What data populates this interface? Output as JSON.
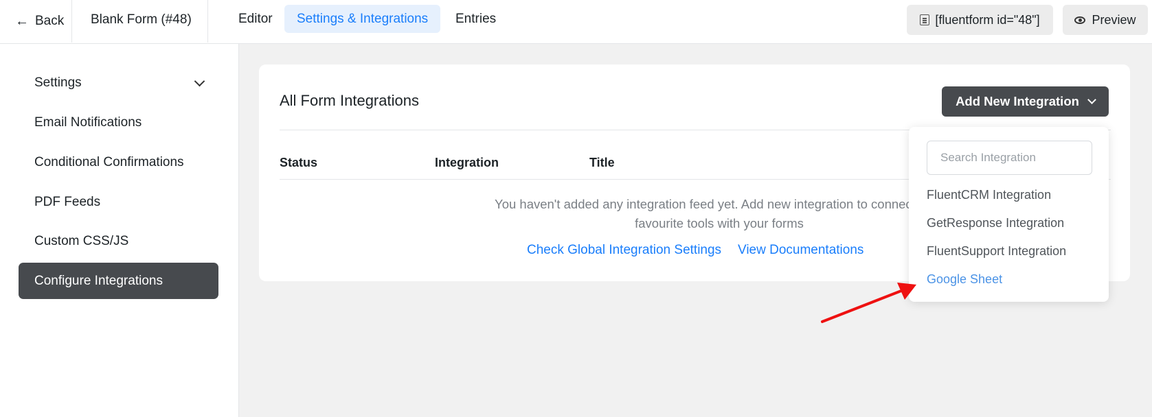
{
  "header": {
    "back_label": "Back",
    "form_name": "Blank Form (#48)",
    "tabs": [
      {
        "label": "Editor"
      },
      {
        "label": "Settings & Integrations"
      },
      {
        "label": "Entries"
      }
    ],
    "shortcode_label": "[fluentform id=\"48\"]",
    "preview_label": "Preview"
  },
  "sidebar": {
    "items": [
      {
        "label": "Settings"
      },
      {
        "label": "Email Notifications"
      },
      {
        "label": "Conditional Confirmations"
      },
      {
        "label": "PDF Feeds"
      },
      {
        "label": "Custom CSS/JS"
      },
      {
        "label": "Configure Integrations"
      }
    ]
  },
  "main": {
    "title": "All Form Integrations",
    "add_button_label": "Add New Integration",
    "columns": [
      "Status",
      "Integration",
      "Title"
    ],
    "empty_message": "You haven't added any integration feed yet. Add new integration to connect your favourite tools with your forms",
    "links": {
      "global_settings": "Check Global Integration Settings",
      "docs": "View Documentations"
    }
  },
  "dropdown": {
    "search_placeholder": "Search Integration",
    "items": [
      {
        "label": "FluentCRM Integration"
      },
      {
        "label": "GetResponse Integration"
      },
      {
        "label": "FluentSupport Integration"
      },
      {
        "label": "Google Sheet"
      }
    ]
  },
  "colors": {
    "accent": "#1a7efb",
    "dark_button": "#474a4e",
    "annotation_arrow": "#ee1111"
  }
}
